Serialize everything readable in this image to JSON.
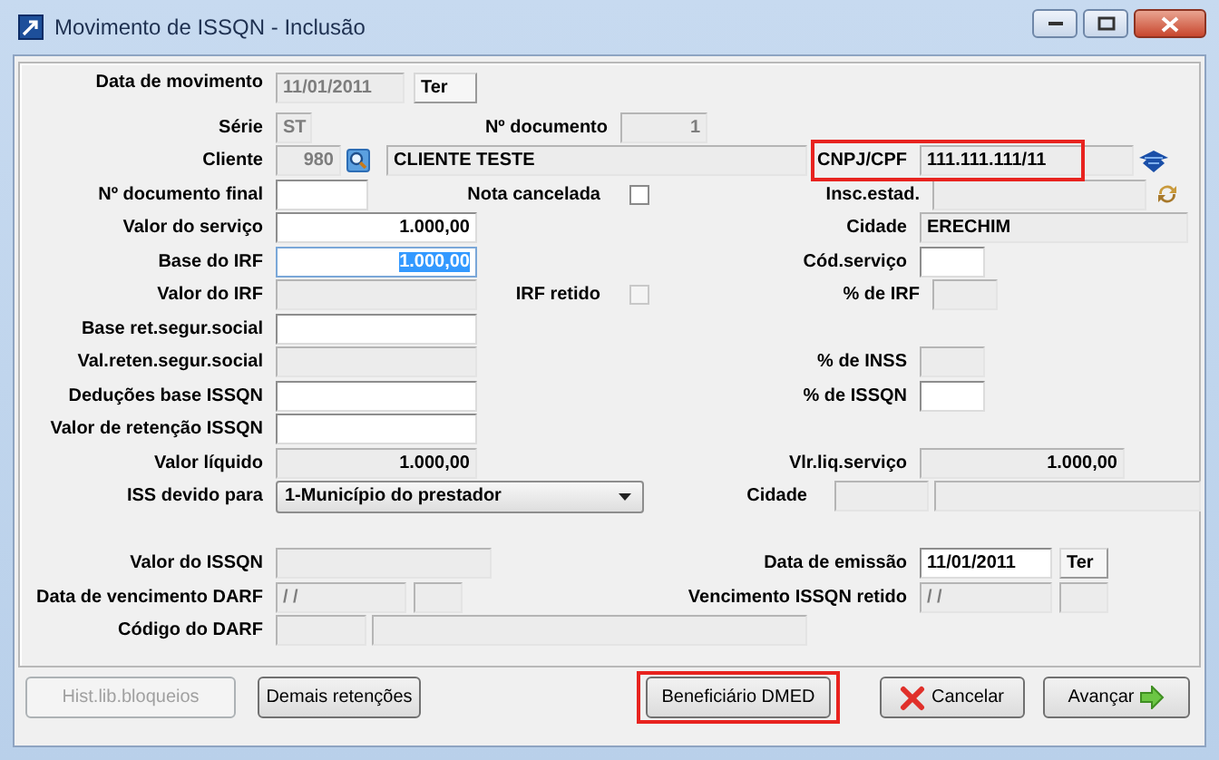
{
  "window": {
    "title": "Movimento de ISSQN - Inclusão"
  },
  "form": {
    "data_movimento": {
      "label": "Data de movimento",
      "value": "11/01/2011",
      "disabled": true,
      "weekday": "Ter"
    },
    "serie": {
      "label": "Série",
      "value": "ST",
      "disabled": true
    },
    "numero_documento": {
      "label": "Nº documento",
      "value": "1",
      "disabled": true
    },
    "cliente": {
      "label": "Cliente",
      "code": "980",
      "name": "CLIENTE TESTE",
      "disabled": true
    },
    "cnpj_cpf": {
      "label": "CNPJ/CPF",
      "value": "111.111.111/11",
      "disabled": true,
      "marked": true
    },
    "numero_documento_final": {
      "label": "Nº documento final",
      "disabled": false
    },
    "nota_cancelada": {
      "label": "Nota cancelada",
      "checked": false,
      "disabled": false
    },
    "insc_estad": {
      "label": "Insc.estad.",
      "disabled": true
    },
    "valor_servico": {
      "label": "Valor do serviço",
      "value": "1.000,00",
      "disabled": false
    },
    "cidade": {
      "label": "Cidade",
      "value": "ERECHIM",
      "disabled": true
    },
    "base_irf": {
      "label": "Base do IRF",
      "value": "1.000,00",
      "disabled": false,
      "text_selected": true
    },
    "cod_servico": {
      "label": "Cód.serviço",
      "disabled": false
    },
    "valor_irf": {
      "label": "Valor do IRF",
      "disabled": true
    },
    "irf_retido": {
      "label": "IRF retido",
      "checked": false,
      "disabled": true
    },
    "pct_irf": {
      "label": "% de IRF",
      "disabled": true
    },
    "base_ret_segur_social": {
      "label": "Base ret.segur.social",
      "disabled": false
    },
    "val_reten_segur_social": {
      "label": "Val.reten.segur.social",
      "disabled": true
    },
    "pct_inss": {
      "label": "% de INSS",
      "disabled": true
    },
    "deducoes_base_issqn": {
      "label": "Deduções base ISSQN",
      "disabled": false
    },
    "pct_issqn": {
      "label": "% de ISSQN",
      "disabled": false
    },
    "valor_retencao_issqn": {
      "label": "Valor de retenção ISSQN",
      "disabled": false
    },
    "valor_liquido": {
      "label": "Valor líquido",
      "value": "1.000,00",
      "disabled": true
    },
    "vlr_liq_servico": {
      "label": "Vlr.liq.serviço",
      "value": "1.000,00",
      "disabled": true
    },
    "iss_devido_para": {
      "label": "ISS devido para",
      "value": "1-Município do prestador"
    },
    "cidade_prestacao": {
      "label": "Cidade",
      "disabled": true
    },
    "valor_issqn": {
      "label": "Valor do ISSQN",
      "disabled": true
    },
    "data_emissao": {
      "label": "Data de emissão",
      "value": "11/01/2011",
      "disabled": false,
      "weekday": "Ter"
    },
    "data_vencimento_darf": {
      "label": "Data de vencimento DARF",
      "value": "/ /",
      "disabled": true
    },
    "vencimento_issqn_retido": {
      "label": "Vencimento ISSQN retido",
      "value": "/ /",
      "disabled": true
    },
    "codigo_darf": {
      "label": "Código do DARF",
      "disabled": true
    }
  },
  "buttons": [
    {
      "label": "Hist.lib.bloqueios",
      "disabled": true,
      "marked": false
    },
    {
      "label": "Demais retenções",
      "disabled": false,
      "marked": false
    },
    {
      "label": "Beneficiário DMED",
      "disabled": false,
      "marked": true
    },
    {
      "label": "Cancelar",
      "disabled": false,
      "marked": false,
      "kind": "cancel"
    },
    {
      "label": "Avançar",
      "disabled": false,
      "marked": false,
      "kind": "next"
    }
  ]
}
